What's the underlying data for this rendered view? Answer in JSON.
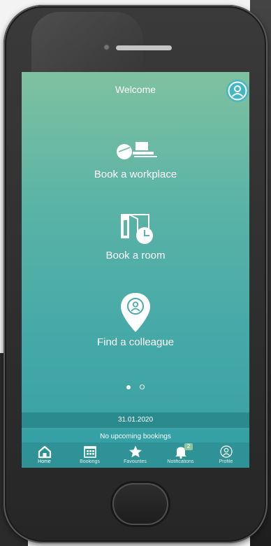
{
  "header": {
    "title": "Welcome",
    "profile_icon": "user-circle-icon"
  },
  "tiles": [
    {
      "label": "Book a workplace",
      "icon": "desk-icon"
    },
    {
      "label": "Book a room",
      "icon": "room-clock-icon"
    },
    {
      "label": "Find a colleague",
      "icon": "location-pin-user-icon"
    }
  ],
  "pager": {
    "total": 2,
    "active": 1
  },
  "date_bar": {
    "text": "31.01.2020"
  },
  "status_bar": {
    "text": "No upcoming bookings"
  },
  "tabbar": {
    "items": [
      {
        "label": "Home",
        "icon": "home-icon",
        "active": true
      },
      {
        "label": "Bookings",
        "icon": "calendar-icon",
        "active": false
      },
      {
        "label": "Favourites",
        "icon": "star-icon",
        "active": false
      },
      {
        "label": "Notifications",
        "icon": "bell-icon",
        "active": false,
        "badge": "2"
      },
      {
        "label": "Profile",
        "icon": "user-circle-icon",
        "active": false
      }
    ]
  },
  "colors": {
    "gradient_top": "#7fc1a0",
    "gradient_bottom": "#3a9fa3",
    "tabbar": "#2f9296",
    "date_bar": "#2b8a8e",
    "badge": "#8cc49d",
    "profile_accent": "#43b7c4"
  }
}
